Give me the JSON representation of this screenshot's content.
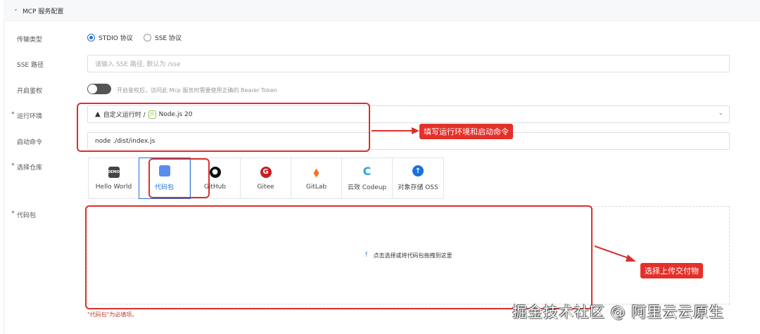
{
  "section": {
    "title": "MCP 服务配置"
  },
  "form": {
    "transport": {
      "label": "传输类型",
      "options": [
        "STDIO 协议",
        "SSE 协议"
      ],
      "selected": "STDIO 协议"
    },
    "sse_path": {
      "label": "SSE 路径",
      "placeholder": "请输入 SSE 路径, 默认为 /sse"
    },
    "auth": {
      "label": "开启鉴权",
      "enabled": false,
      "hint": "开启鉴权后，访问此 Mcp 服务时需要使用正确的 Bearer Token"
    },
    "runtime": {
      "label": "运行环境",
      "value_prefix": "自定义运行时 /",
      "value": "Node.js 20"
    },
    "command": {
      "label": "启动命令",
      "value": "node ./dist/index.js"
    },
    "repo": {
      "label": "选择仓库",
      "options": [
        "Hello World",
        "代码包",
        "GitHub",
        "Gitee",
        "GitLab",
        "云效 Codeup",
        "对象存储 OSS"
      ],
      "selected": "代码包"
    },
    "package": {
      "label": "代码包",
      "upload_hint": "点击选择或将代码包拖拽到这里",
      "error": "\"代码包\"为必填项。"
    }
  },
  "annotations": {
    "runtime_note": "填写运行环境和启动命令",
    "upload_note": "选择上传交付物"
  },
  "watermark": "掘金技术社区 @ 阿里云云原生",
  "colors": {
    "accent": "#1f6fd1",
    "annotation": "#e5302a",
    "error": "#c0392b"
  }
}
